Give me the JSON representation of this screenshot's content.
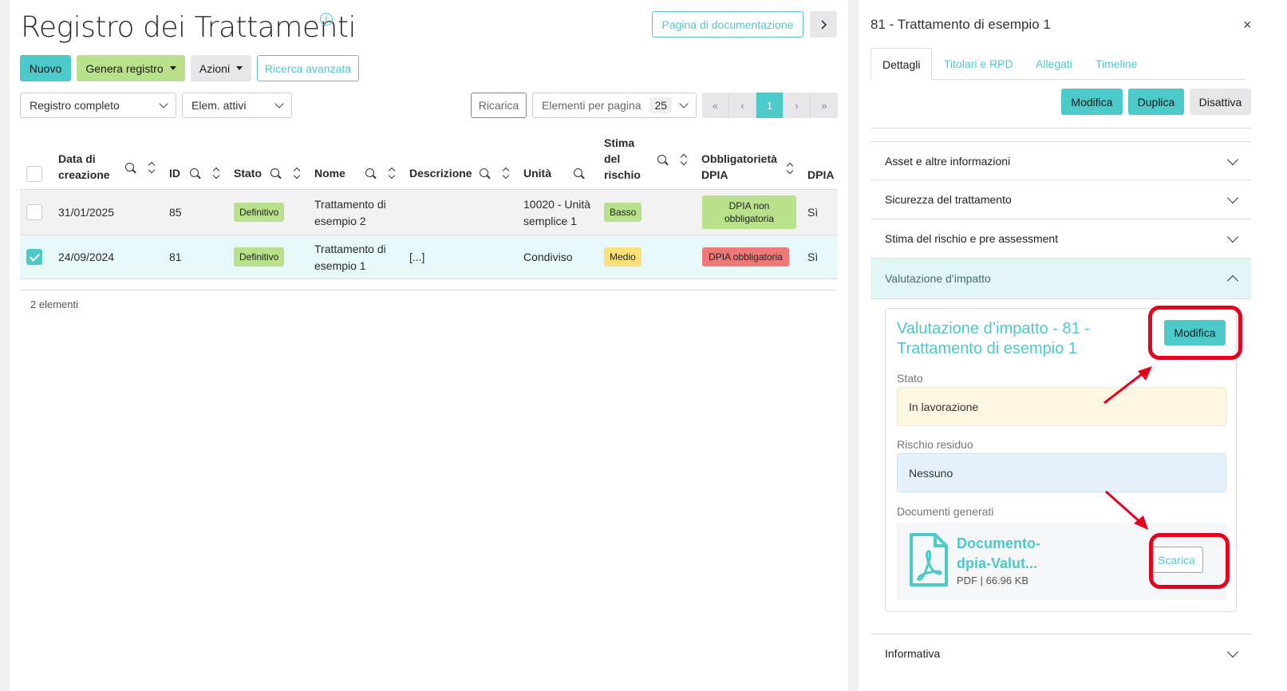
{
  "main": {
    "title": "Registro dei Trattamenti",
    "doc_button": "Pagina di documentazione",
    "toolbar": {
      "new": "Nuovo",
      "generate": "Genera registro",
      "actions": "Azioni",
      "advanced_search": "Ricerca avanzata"
    },
    "filters": {
      "register": "Registro completo",
      "elements": "Elem. attivi",
      "reload": "Ricarica",
      "per_page_label": "Elementi per pagina",
      "per_page_value": "25"
    },
    "pagination": {
      "current": "1"
    },
    "columns": {
      "created": "Data di creazione",
      "id": "ID",
      "state": "Stato",
      "name": "Nome",
      "description": "Descrizione",
      "unit": "Unità",
      "risk": "Stima del rischio",
      "dpia_required": "Obbligatorietà DPIA",
      "dpia": "DPIA"
    },
    "rows": [
      {
        "created": "31/01/2025",
        "id": "85",
        "state": "Definitivo",
        "name": "Trattamento di esempio 2",
        "description": "",
        "unit": "10020 - Unità semplice 1",
        "risk": "Basso",
        "dpia_required": "DPIA non obbligatoria",
        "dpia": "Sì",
        "checked": false
      },
      {
        "created": "24/09/2024",
        "id": "81",
        "state": "Definitivo",
        "name": "Trattamento di esempio 1",
        "description": "[...]",
        "unit": "Condiviso",
        "risk": "Medio",
        "dpia_required": "DPIA obbligatoria",
        "dpia": "Sì",
        "checked": true
      }
    ],
    "count": "2 elementi"
  },
  "panel": {
    "title": "81 - Trattamento di esempio 1",
    "close": "×",
    "tabs": [
      "Dettagli",
      "Titolari e RPD",
      "Allegati",
      "Timeline"
    ],
    "actions": {
      "edit": "Modifica",
      "duplicate": "Duplica",
      "disable": "Disattiva"
    },
    "sections": {
      "asset": "Asset e altre informazioni",
      "security": "Sicurezza del trattamento",
      "risk": "Stima del rischio e pre assessment",
      "impact": "Valutazione d’impatto",
      "info": "Informativa"
    },
    "impact_card": {
      "title": "Valutazione d’impatto - 81 - Trattamento di esempio 1",
      "edit": "Modifica",
      "state_label": "Stato",
      "state_value": "In lavorazione",
      "residual_label": "Rischio residuo",
      "residual_value": "Nessuno",
      "docs_label": "Documenti generati",
      "doc_name": "Documento-dpia-Valut...",
      "doc_meta": "PDF | 66.96 KB",
      "download": "Scarica"
    }
  },
  "colors": {
    "accent": "#4cc9c9",
    "green": "#b9e08a",
    "annotation_red": "#e8001c"
  }
}
